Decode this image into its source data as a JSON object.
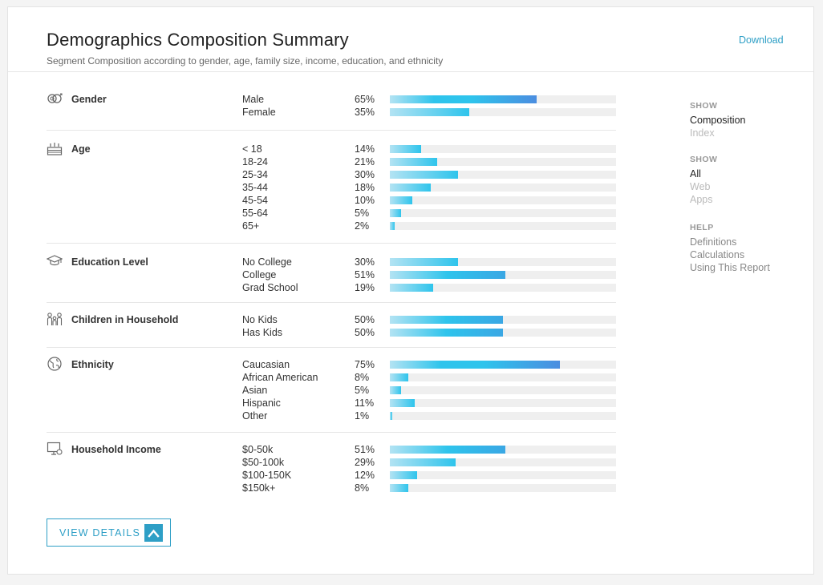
{
  "header": {
    "title": "Demographics Composition Summary",
    "subtitle": "Segment Composition according to gender, age, family size, income, education, and ethnicity",
    "download_label": "Download"
  },
  "sections": [
    {
      "label": "Gender",
      "icon": "gender-icon",
      "rows": [
        {
          "label": "Male",
          "pct": "65%",
          "value": 65
        },
        {
          "label": "Female",
          "pct": "35%",
          "value": 35
        }
      ]
    },
    {
      "label": "Age",
      "icon": "birthday-cake-icon",
      "rows": [
        {
          "label": "< 18",
          "pct": "14%",
          "value": 14
        },
        {
          "label": "18-24",
          "pct": "21%",
          "value": 21
        },
        {
          "label": "25-34",
          "pct": "30%",
          "value": 30
        },
        {
          "label": "35-44",
          "pct": "18%",
          "value": 18
        },
        {
          "label": "45-54",
          "pct": "10%",
          "value": 10
        },
        {
          "label": "55-64",
          "pct": "5%",
          "value": 5
        },
        {
          "label": "65+",
          "pct": "2%",
          "value": 2
        }
      ]
    },
    {
      "label": "Education Level",
      "icon": "graduation-cap-icon",
      "rows": [
        {
          "label": "No College",
          "pct": "30%",
          "value": 30
        },
        {
          "label": "College",
          "pct": "51%",
          "value": 51
        },
        {
          "label": "Grad School",
          "pct": "19%",
          "value": 19
        }
      ]
    },
    {
      "label": "Children in Household",
      "icon": "family-icon",
      "rows": [
        {
          "label": "No Kids",
          "pct": "50%",
          "value": 50
        },
        {
          "label": "Has Kids",
          "pct": "50%",
          "value": 50
        }
      ]
    },
    {
      "label": "Ethnicity",
      "icon": "globe-icon",
      "rows": [
        {
          "label": "Caucasian",
          "pct": "75%",
          "value": 75
        },
        {
          "label": "African American",
          "pct": "8%",
          "value": 8
        },
        {
          "label": "Asian",
          "pct": "5%",
          "value": 5
        },
        {
          "label": "Hispanic",
          "pct": "11%",
          "value": 11
        },
        {
          "label": "Other",
          "pct": "1%",
          "value": 1
        }
      ]
    },
    {
      "label": "Household Income",
      "icon": "computer-money-icon",
      "rows": [
        {
          "label": "$0-50k",
          "pct": "51%",
          "value": 51
        },
        {
          "label": "$50-100k",
          "pct": "29%",
          "value": 29
        },
        {
          "label": "$100-150K",
          "pct": "12%",
          "value": 12
        },
        {
          "label": "$150k+",
          "pct": "8%",
          "value": 8
        }
      ]
    }
  ],
  "sidebar": {
    "show1_heading": "SHOW",
    "show1_items": [
      {
        "label": "Composition",
        "active": true
      },
      {
        "label": "Index",
        "active": false
      }
    ],
    "show2_heading": "SHOW",
    "show2_items": [
      {
        "label": "All",
        "active": true
      },
      {
        "label": "Web",
        "active": false
      },
      {
        "label": "Apps",
        "active": false
      }
    ],
    "help_heading": "HELP",
    "help_items": [
      {
        "label": "Definitions"
      },
      {
        "label": "Calculations"
      },
      {
        "label": "Using This Report"
      }
    ]
  },
  "view_details": {
    "label": "VIEW DETAILS",
    "icon": "chevron-up-icon"
  },
  "colors": {
    "accent": "#2e9fc6",
    "bar_light": "#b3e3f3",
    "bar_mid": "#2ec4ec",
    "bar_dark": "#4b8de0",
    "track": "#efefef"
  }
}
